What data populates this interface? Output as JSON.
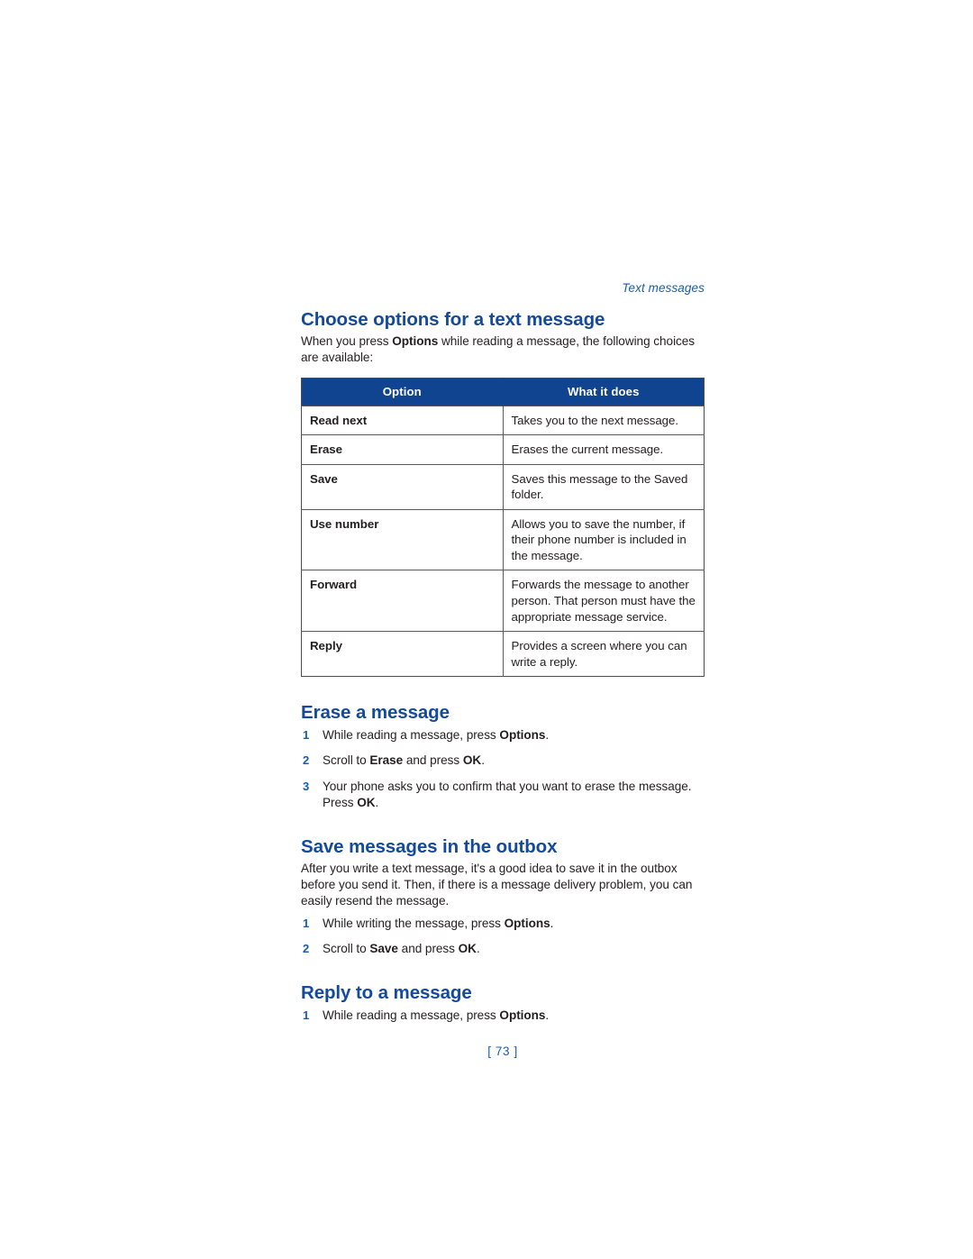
{
  "running_head": "Text messages",
  "page_number": "[ 73 ]",
  "sections": [
    {
      "heading": "Choose options for a text message",
      "intro_pre": "When you press ",
      "intro_bold": "Options",
      "intro_post": " while reading a message, the following choices are available:"
    },
    {
      "heading": "Erase a message"
    },
    {
      "heading": "Save messages in the outbox",
      "intro": "After you write a text message, it's a good idea to save it in the outbox before you send it. Then, if there is a message delivery problem, you can easily resend the message."
    },
    {
      "heading": "Reply to a message"
    }
  ],
  "table": {
    "headers": [
      "Option",
      "What it does"
    ],
    "rows": [
      {
        "option": "Read next",
        "description": "Takes you to the next message."
      },
      {
        "option": "Erase",
        "description": "Erases the current message."
      },
      {
        "option": "Save",
        "description": "Saves this message to the Saved folder."
      },
      {
        "option": "Use number",
        "description": "Allows you to save the number, if their phone number is included in the message."
      },
      {
        "option": "Forward",
        "description": "Forwards the message to another person. That person must have the appropriate message service."
      },
      {
        "option": "Reply",
        "description": "Provides a screen where you can write a reply."
      }
    ]
  },
  "erase_steps": {
    "s1_num": "1",
    "s1_pre": "While reading a message, press ",
    "s1_bold": "Options",
    "s1_post": ".",
    "s2_num": "2",
    "s2_pre": "Scroll to ",
    "s2_bold1": "Erase",
    "s2_mid": " and press ",
    "s2_bold2": "OK",
    "s2_post": ".",
    "s3_num": "3",
    "s3_pre": "Your phone asks you to confirm that you want to erase the message. Press ",
    "s3_bold": "OK",
    "s3_post": "."
  },
  "outbox_steps": {
    "s1_num": "1",
    "s1_pre": "While writing the message, press ",
    "s1_bold": "Options",
    "s1_post": ".",
    "s2_num": "2",
    "s2_pre": "Scroll to ",
    "s2_bold1": "Save",
    "s2_mid": " and press ",
    "s2_bold2": "OK",
    "s2_post": "."
  },
  "reply_steps": {
    "s1_num": "1",
    "s1_pre": "While reading a message, press ",
    "s1_bold": "Options",
    "s1_post": "."
  },
  "colors": {
    "heading_blue": "#134A9B",
    "accent_blue": "#1B5CAB",
    "table_header_bg": "#114490",
    "body_text": "#231F20",
    "table_border": "#58595B"
  }
}
